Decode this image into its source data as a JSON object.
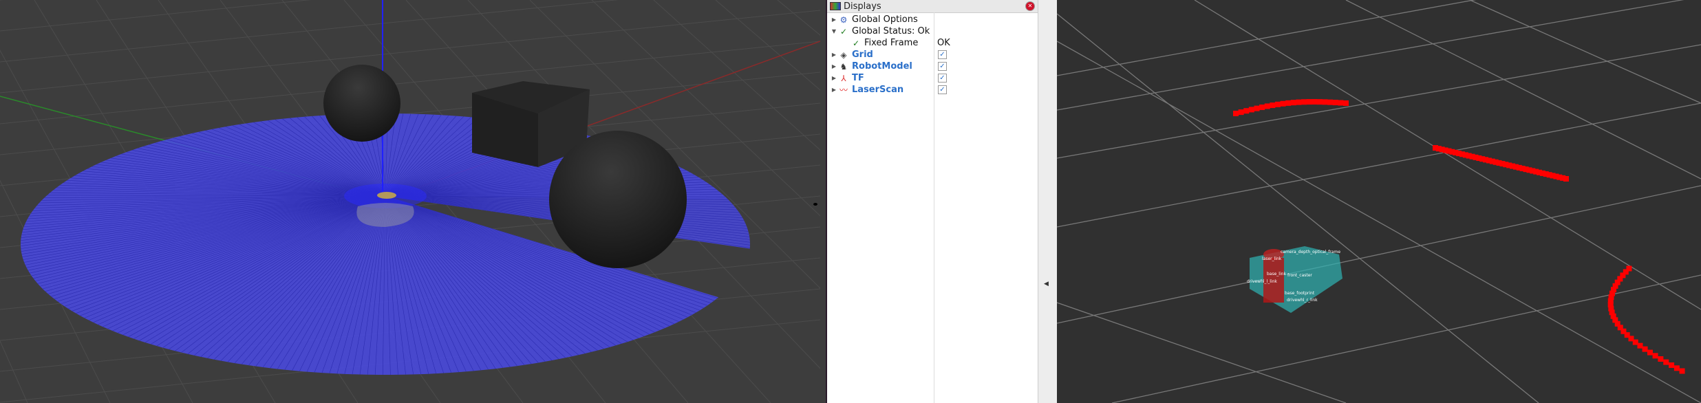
{
  "displays_panel": {
    "title": "Displays",
    "items": [
      {
        "label": "Global Options",
        "icon": "gear-icon",
        "expanded": false,
        "value": ""
      },
      {
        "label": "Global Status: Ok",
        "icon": "check-icon",
        "expanded": true,
        "value": ""
      },
      {
        "label": "Fixed Frame",
        "icon": "check-icon",
        "value": "OK",
        "child": true
      },
      {
        "label": "Grid",
        "icon": "grid-icon",
        "checked": true
      },
      {
        "label": "RobotModel",
        "icon": "robot-icon",
        "checked": true
      },
      {
        "label": "TF",
        "icon": "axes-icon",
        "checked": true
      },
      {
        "label": "LaserScan",
        "icon": "laser-icon",
        "checked": true
      }
    ]
  },
  "robot_frame_labels": [
    "camera_depth_optical_frame",
    "laser_link",
    "base_link",
    "front_caster",
    "drivewhl_l_link",
    "base_footprint",
    "drivewhl_r_link"
  ],
  "colors": {
    "laser_gazebo": "#4a4ae6",
    "laser_rviz": "#ff0000",
    "robot_body": "#2fb3b3",
    "link_highlight": "#b01818",
    "accent_blue": "#2a6fc9"
  }
}
